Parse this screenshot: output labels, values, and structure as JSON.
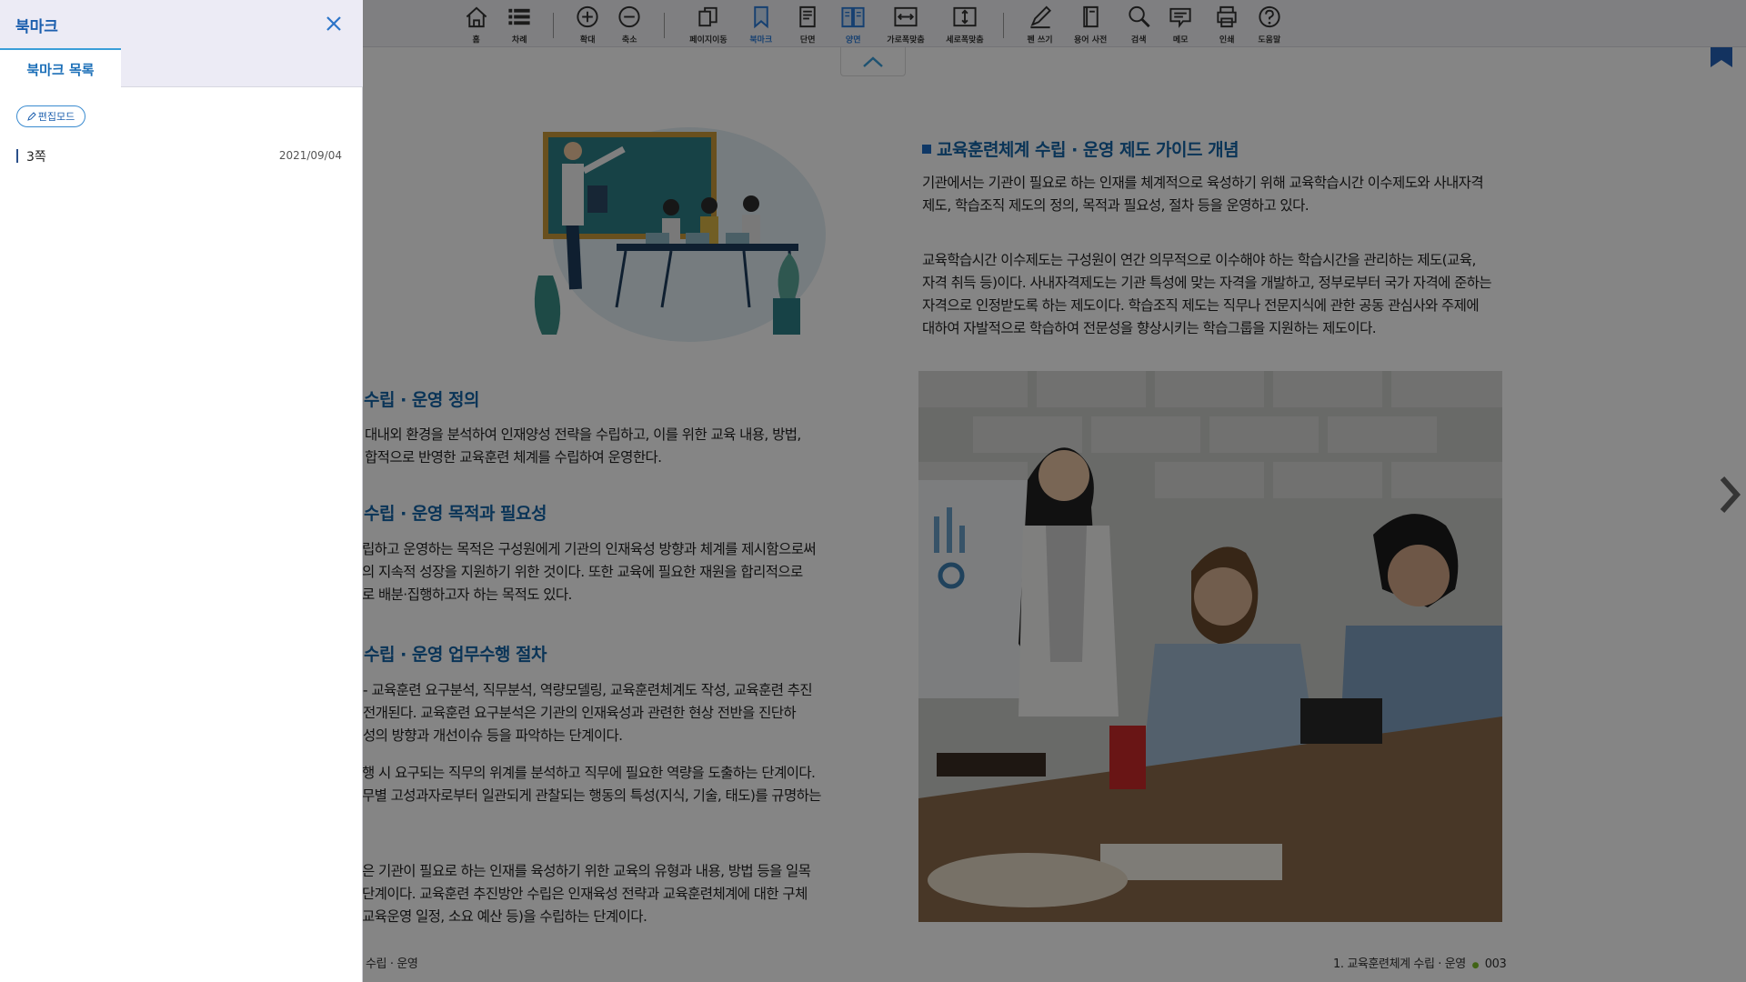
{
  "toolbar": {
    "items": [
      {
        "label": "홈",
        "icon": "home-icon"
      },
      {
        "label": "차례",
        "icon": "list-icon"
      },
      {
        "label": "확대",
        "icon": "zoom-in-icon"
      },
      {
        "label": "축소",
        "icon": "zoom-out-icon"
      },
      {
        "label": "페이지이동",
        "icon": "page-move-icon"
      },
      {
        "label": "북마크",
        "icon": "bookmark-icon",
        "active": true
      },
      {
        "label": "단면",
        "icon": "single-page-icon"
      },
      {
        "label": "양면",
        "icon": "double-page-icon",
        "active": true
      },
      {
        "label": "가로폭맞춤",
        "icon": "fit-width-icon"
      },
      {
        "label": "세로폭맞춤",
        "icon": "fit-height-icon"
      },
      {
        "label": "펜 쓰기",
        "icon": "pen-icon"
      },
      {
        "label": "용어 사전",
        "icon": "dictionary-icon"
      },
      {
        "label": "검색",
        "icon": "search-icon"
      },
      {
        "label": "메모",
        "icon": "memo-icon"
      },
      {
        "label": "인쇄",
        "icon": "print-icon"
      },
      {
        "label": "도움말",
        "icon": "help-icon"
      }
    ],
    "accent_color": "#2b7bd8"
  },
  "panel": {
    "title": "북마크",
    "tab_label": "북마크 목록",
    "edit_mode_label": "편집모드",
    "bookmarks": [
      {
        "page": "3쪽",
        "date": "2021/09/04"
      }
    ],
    "title_color": "#1c5fae"
  },
  "left_page": {
    "sections": [
      {
        "heading": "수립 · 운영 정의",
        "lines": [
          "대내외 환경을 분석하여 인재양성 전략을 수립하고, 이를 위한 교육 내용, 방법,",
          "합적으로 반영한 교육훈련 체계를 수립하여 운영한다."
        ]
      },
      {
        "heading": "수립 · 운영 목적과 필요성",
        "lines": [
          "립하고 운영하는 목적은 구성원에게 기관의 인재육성 방향과 체계를 제시함으로써",
          "의 지속적 성장을 지원하기 위한 것이다.  또한 교육에 필요한 재원을 합리적으로",
          "로 배분·집행하고자 하는 목적도 있다."
        ]
      },
      {
        "heading": "수립 · 운영 업무수행 절차",
        "lines": [
          "- 교육훈련 요구분석, 직무분석, 역량모델링, 교육훈련체계도 작성, 교육훈련 추진",
          "전개된다.  교육훈련 요구분석은 기관의 인재육성과 관련한 현상 전반을 진단하",
          "성의 방향과 개선이슈 등을 파악하는 단계이다."
        ]
      }
    ],
    "extra_paragraphs": [
      [
        "행 시 요구되는 직무의 위계를 분석하고 직무에 필요한 역량을 도출하는 단계이다.",
        "무별 고성과자로부터 일관되게 관찰되는 행동의 특성(지식, 기술, 태도)를 규명하는"
      ],
      [
        "은 기관이 필요로 하는 인재를 육성하기 위한 교육의 유형과 내용, 방법 등을 일목",
        "단계이다.  교육훈련 추진방안 수립은 인재육성 전략과 교육훈련체계에 대한 구체",
        "교육운영 일정, 소요 예산 등)을 수립하는 단계이다."
      ]
    ],
    "footer": "수립 · 운영"
  },
  "right_page": {
    "heading": "교육훈련체계 수립 · 운영 제도 가이드 개념",
    "para1": [
      "기관에서는 기관이 필요로 하는 인재를 체계적으로 육성하기 위해 교육학습시간 이수제도와 사내자격",
      "제도, 학습조직 제도의 정의, 목적과 필요성, 절차 등을 운영하고 있다."
    ],
    "para2": [
      "교육학습시간 이수제도는 구성원이 연간 의무적으로 이수해야 하는 학습시간을 관리하는 제도(교육,",
      "자격 취득 등)이다. 사내자격제도는 기관 특성에 맞는 자격을 개발하고, 정부로부터 국가 자격에 준하는",
      "자격으로 인정받도록 하는 제도이다. 학습조직 제도는 직무나 전문지식에 관한 공동 관심사와 주제에",
      "대하여 자발적으로 학습하여 전문성을 향상시키는 학습그룹을 지원하는 제도이다."
    ],
    "footer_title": "1. 교육훈련체계 수립 · 운영",
    "footer_dot": "●",
    "page_number": "003"
  }
}
